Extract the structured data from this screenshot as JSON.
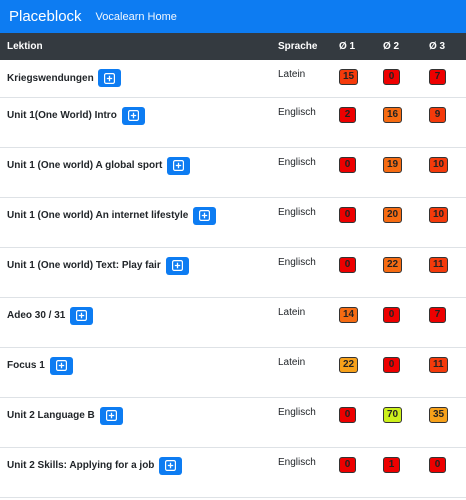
{
  "navbar": {
    "brand": "Placeblock",
    "link": "Vocalearn Home"
  },
  "table": {
    "headers": {
      "lektion": "Lektion",
      "sprache": "Sprache",
      "avg1": "Ø 1",
      "avg2": "Ø 2",
      "avg3": "Ø 3"
    },
    "rows": [
      {
        "name": "Kriegswendungen",
        "sprache": "Latein",
        "a1": "15",
        "a2": "0",
        "a3": "7"
      },
      {
        "name": "Unit 1(One World) Intro",
        "sprache": "Englisch",
        "a1": "2",
        "a2": "16",
        "a3": "9"
      },
      {
        "name": "Unit 1 (One world) A global sport",
        "sprache": "Englisch",
        "a1": "0",
        "a2": "19",
        "a3": "10"
      },
      {
        "name": "Unit 1 (One world) An internet lifestyle",
        "sprache": "Englisch",
        "a1": "0",
        "a2": "20",
        "a3": "10"
      },
      {
        "name": "Unit 1 (One world) Text: Play fair",
        "sprache": "Englisch",
        "a1": "0",
        "a2": "22",
        "a3": "11"
      },
      {
        "name": "Adeo 30 / 31",
        "sprache": "Latein",
        "a1": "14",
        "a2": "0",
        "a3": "7"
      },
      {
        "name": "Focus 1",
        "sprache": "Latein",
        "a1": "22",
        "a2": "0",
        "a3": "11"
      },
      {
        "name": "Unit 2 Language B",
        "sprache": "Englisch",
        "a1": "0",
        "a2": "70",
        "a3": "35"
      },
      {
        "name": "Unit 2 Skills: Applying for a job",
        "sprache": "Englisch",
        "a1": "0",
        "a2": "1",
        "a3": "0"
      }
    ]
  },
  "icons": {
    "add": "plus-square-icon"
  }
}
